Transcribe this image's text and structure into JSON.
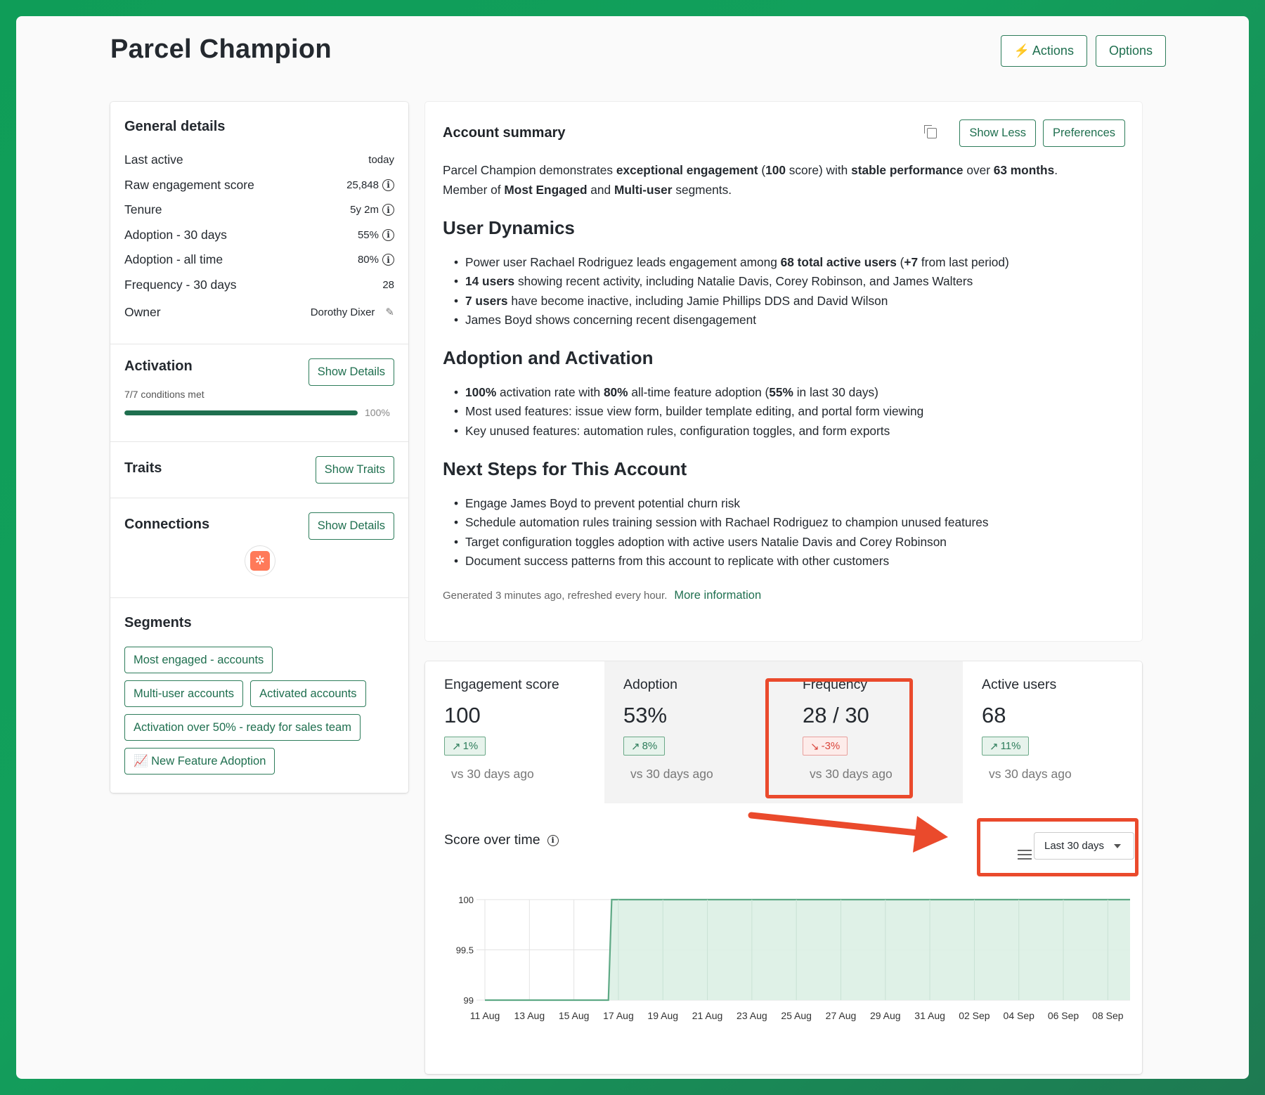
{
  "page": {
    "title": "Parcel Champion"
  },
  "top_actions": {
    "actions_label": "⚡ Actions",
    "options_label": "Options"
  },
  "general": {
    "title": "General details",
    "rows": [
      {
        "label": "Last active",
        "value": "today",
        "info": false
      },
      {
        "label": "Raw engagement score",
        "value": "25,848",
        "info": true
      },
      {
        "label": "Tenure",
        "value": "5y 2m",
        "info": true
      },
      {
        "label": "Adoption - 30 days",
        "value": "55%",
        "info": true
      },
      {
        "label": "Adoption - all time",
        "value": "80%",
        "info": true
      },
      {
        "label": "Frequency - 30 days",
        "value": "28",
        "info": false
      }
    ],
    "owner_label": "Owner",
    "owner_value": "Dorothy Dixer"
  },
  "activation": {
    "title": "Activation",
    "button": "Show Details",
    "conditions": "7/7 conditions met",
    "progress": 1.0,
    "progress_label": "100%"
  },
  "traits": {
    "title": "Traits",
    "button": "Show Traits"
  },
  "connections": {
    "title": "Connections",
    "button": "Show Details",
    "logo_icon": "hubspot-icon"
  },
  "segments": {
    "title": "Segments",
    "chips": [
      "Most engaged - accounts",
      "Multi-user accounts",
      "Activated accounts",
      "Activation over 50% - ready for sales team",
      "📈 New Feature Adoption"
    ]
  },
  "summary": {
    "title": "Account summary",
    "show_less": "Show Less",
    "preferences": "Preferences",
    "intro_1a": "Parcel Champion demonstrates ",
    "intro_1b": "exceptional engagement",
    "intro_1c": " (",
    "intro_1d": "100",
    "intro_1e": " score) with ",
    "intro_1f": "stable performance",
    "intro_1g": " over ",
    "intro_1h": "63 months",
    "intro_1i": ".",
    "intro_2a": "Member of ",
    "intro_2b": "Most Engaged",
    "intro_2c": " and ",
    "intro_2d": "Multi-user",
    "intro_2e": " segments.",
    "h_user": "User Dynamics",
    "u1a": "Power user Rachael Rodriguez leads engagement among ",
    "u1b": "68 total active users",
    "u1c": " (",
    "u1d": "+7",
    "u1e": " from last period)",
    "u2a": "14 users",
    "u2b": " showing recent activity, including Natalie Davis, Corey Robinson, and James Walters",
    "u3a": "7 users",
    "u3b": " have become inactive, including Jamie Phillips DDS and David Wilson",
    "u4": "James Boyd shows concerning recent disengagement",
    "h_adopt": "Adoption and Activation",
    "a1a": "100%",
    "a1b": " activation rate with ",
    "a1c": "80%",
    "a1d": " all-time feature adoption (",
    "a1e": "55%",
    "a1f": " in last 30 days)",
    "a2": "Most used features: issue view form, builder template editing, and portal form viewing",
    "a3": "Key unused features: automation rules, configuration toggles, and form exports",
    "h_next": "Next Steps for This Account",
    "n1": "Engage James Boyd to prevent potential churn risk",
    "n2": "Schedule automation rules training session with Rachael Rodriguez to champion unused features",
    "n3": "Target configuration toggles adoption with active users Natalie Davis and Corey Robinson",
    "n4": "Document success patterns from this account to replicate with other customers",
    "generated": "Generated 3 minutes ago, refreshed every hour.",
    "more_info": "More information"
  },
  "tiles": [
    {
      "label": "Engagement score",
      "value": "100",
      "delta": "1%",
      "trend": "up",
      "vs": "vs 30 days ago"
    },
    {
      "label": "Adoption",
      "value": "53%",
      "delta": "8%",
      "trend": "up",
      "vs": "vs 30 days ago"
    },
    {
      "label": "Frequency",
      "value": "28 / 30",
      "delta": "-3%",
      "trend": "down",
      "vs": "vs 30 days ago"
    },
    {
      "label": "Active users",
      "value": "68",
      "delta": "11%",
      "trend": "up",
      "vs": "vs 30 days ago"
    }
  ],
  "score_chart": {
    "title": "Score over time",
    "range_label": "Last 30 days"
  },
  "colors": {
    "accent": "#1f6f4f",
    "chart_fill": "#dcefe4",
    "chart_line": "#5ea985",
    "highlight": "#ea4a2c"
  },
  "chart_data": {
    "type": "area",
    "title": "Score over time",
    "x": [
      "11 Aug",
      "12 Aug",
      "13 Aug",
      "14 Aug",
      "15 Aug",
      "16 Aug",
      "17 Aug",
      "18 Aug",
      "19 Aug",
      "20 Aug",
      "21 Aug",
      "22 Aug",
      "23 Aug",
      "24 Aug",
      "25 Aug",
      "26 Aug",
      "27 Aug",
      "28 Aug",
      "29 Aug",
      "30 Aug",
      "31 Aug",
      "01 Sep",
      "02 Sep",
      "03 Sep",
      "04 Sep",
      "05 Sep",
      "06 Sep",
      "07 Sep",
      "08 Sep",
      "09 Sep"
    ],
    "series": [
      {
        "values": [
          99,
          99,
          99,
          99,
          99,
          99,
          100,
          100,
          100,
          100,
          100,
          100,
          100,
          100,
          100,
          100,
          100,
          100,
          100,
          100,
          100,
          100,
          100,
          100,
          100,
          100,
          100,
          100,
          100,
          100
        ]
      }
    ],
    "x_tick_labels": [
      "11 Aug",
      "13 Aug",
      "15 Aug",
      "17 Aug",
      "19 Aug",
      "21 Aug",
      "23 Aug",
      "25 Aug",
      "27 Aug",
      "29 Aug",
      "31 Aug",
      "02 Sep",
      "04 Sep",
      "06 Sep",
      "08 Sep"
    ],
    "y_ticks": [
      99,
      99.5,
      100
    ],
    "ylim": [
      99,
      100
    ],
    "grid": true,
    "legend": "none"
  }
}
